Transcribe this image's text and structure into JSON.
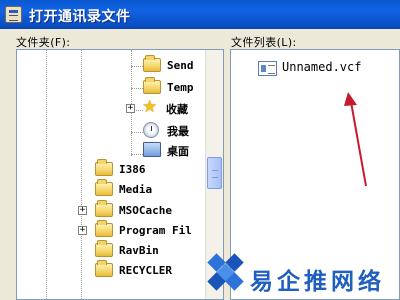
{
  "window": {
    "title": "打开通讯录文件"
  },
  "panes": {
    "folder_label": "文件夹(F):",
    "files_label": "文件列表(L):"
  },
  "tree": [
    {
      "label": "Send",
      "icon": "folder-icon",
      "expander": false
    },
    {
      "label": "Temp",
      "icon": "folder-icon",
      "expander": false
    },
    {
      "label": "收藏",
      "icon": "favorites-star-icon",
      "expander": "+"
    },
    {
      "label": "我最",
      "icon": "history-icon",
      "expander": false
    },
    {
      "label": "桌面",
      "icon": "desktop-icon",
      "expander": false
    },
    {
      "label": "I386",
      "icon": "folder-icon",
      "expander": false
    },
    {
      "label": "Media",
      "icon": "folder-icon",
      "expander": false
    },
    {
      "label": "MSOCache",
      "icon": "folder-icon",
      "expander": "+"
    },
    {
      "label": "Program Fil",
      "icon": "folder-icon",
      "expander": "+"
    },
    {
      "label": "RavBin",
      "icon": "folder-icon",
      "expander": false
    },
    {
      "label": "RECYCLER",
      "icon": "folder-icon",
      "expander": false
    }
  ],
  "files": [
    {
      "name": "Unnamed.vcf",
      "icon": "vcard-file-icon"
    }
  ],
  "colors": {
    "titlebar": "#0b56d0",
    "arrow": "#c51b2f",
    "watermark": "#1f5fbf"
  },
  "watermark": {
    "text": "易企推网络"
  }
}
